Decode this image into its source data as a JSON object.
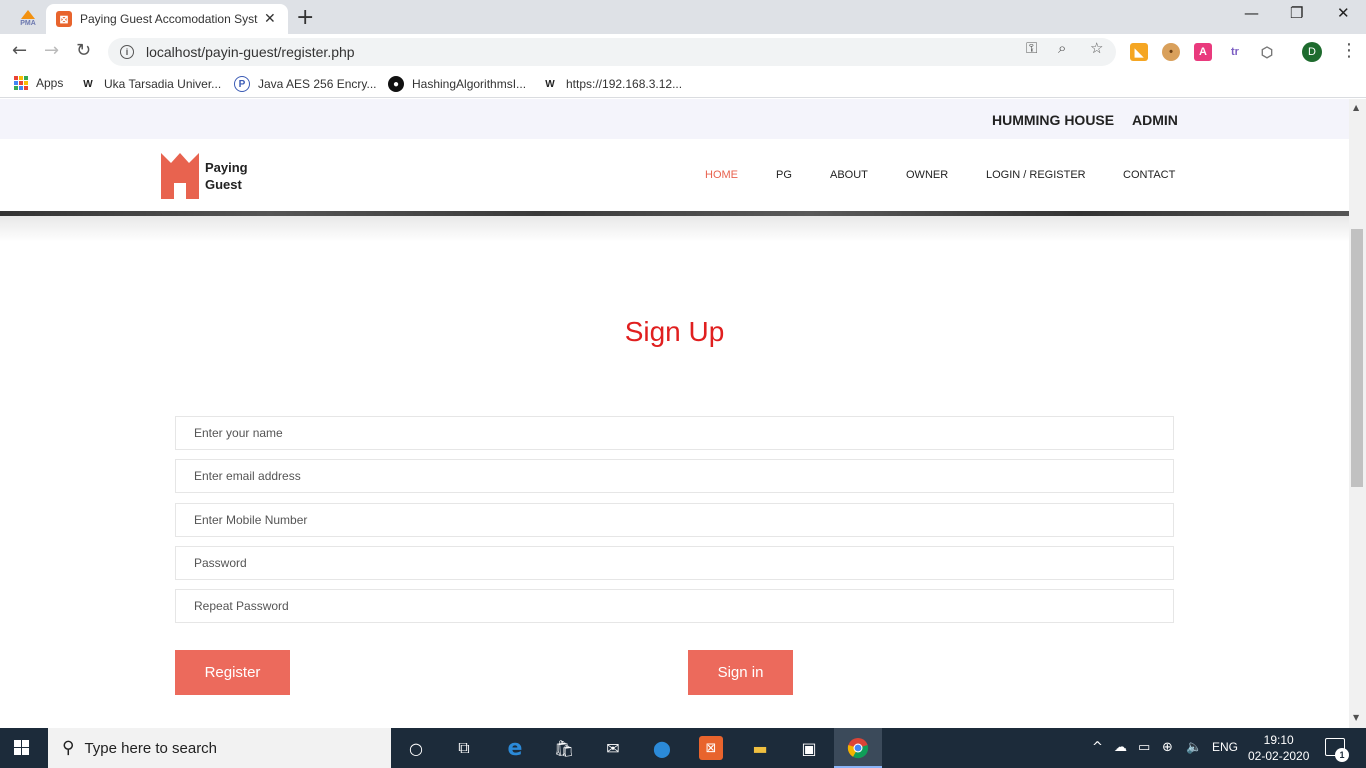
{
  "browser": {
    "pinned_tab_label": "PMA",
    "tab_title": "Paying Guest Accomodation Syst",
    "url": "localhost/payin-guest/register.php",
    "profile_initial": "D",
    "bookmarks": [
      {
        "label": "Apps",
        "icon": "apps-grid-icon"
      },
      {
        "label": "Uka Tarsadia Univer...",
        "icon": "w-logo-icon"
      },
      {
        "label": "Java AES 256 Encry...",
        "icon": "p-logo-icon"
      },
      {
        "label": "HashingAlgorithmsI...",
        "icon": "github-icon"
      },
      {
        "label": "https://192.168.3.12...",
        "icon": "w-logo-icon"
      }
    ],
    "extensions": [
      {
        "name": "orange-extension-icon"
      },
      {
        "name": "cookie-icon"
      },
      {
        "name": "a-extension-icon",
        "label": "A"
      },
      {
        "name": "tr-extension-icon",
        "label": "tr"
      },
      {
        "name": "cube-icon"
      }
    ]
  },
  "site": {
    "topbar": {
      "left_link": "HUMMING HOUSE",
      "right_link": "ADMIN"
    },
    "logo": {
      "line1": "Paying",
      "line2": "Guest"
    },
    "nav": [
      "HOME",
      "PG",
      "ABOUT",
      "OWNER",
      "LOGIN / REGISTER",
      "CONTACT"
    ],
    "active_nav": "HOME",
    "accent_color": "#ec6a5c",
    "title_color": "#e01f1f"
  },
  "form": {
    "title": "Sign Up",
    "fields": [
      {
        "placeholder": "Enter your name"
      },
      {
        "placeholder": "Enter email address"
      },
      {
        "placeholder": "Enter Mobile Number"
      },
      {
        "placeholder": "Password"
      },
      {
        "placeholder": "Repeat Password"
      }
    ],
    "register_label": "Register",
    "signin_label": "Sign in"
  },
  "taskbar": {
    "search_placeholder": "Type here to search",
    "language": "ENG",
    "time": "19:10",
    "date": "02-02-2020",
    "notification_count": "1"
  }
}
